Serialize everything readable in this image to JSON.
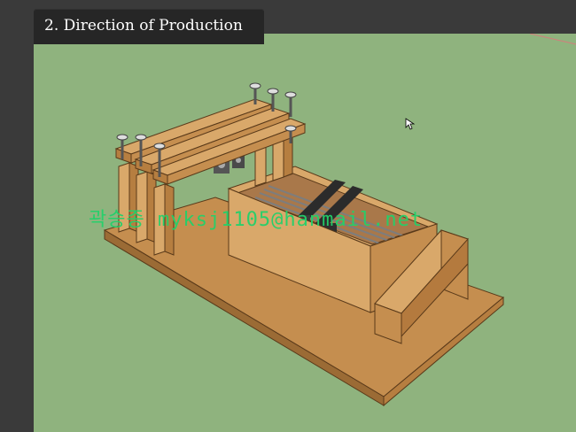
{
  "slide": {
    "title": "2. Direction of Production",
    "watermark": "곽승종 myksj1105@hanmail.net"
  },
  "colors": {
    "canvas_bg": "#8fb37e",
    "wood_light": "#d9a86a",
    "wood_mid": "#c58e4f",
    "wood_dark": "#9b6b35",
    "dark_bar": "#2b2b2b",
    "watermark": "#22d16a"
  },
  "icons": [
    "screw-icon",
    "pointer-cursor-icon"
  ]
}
